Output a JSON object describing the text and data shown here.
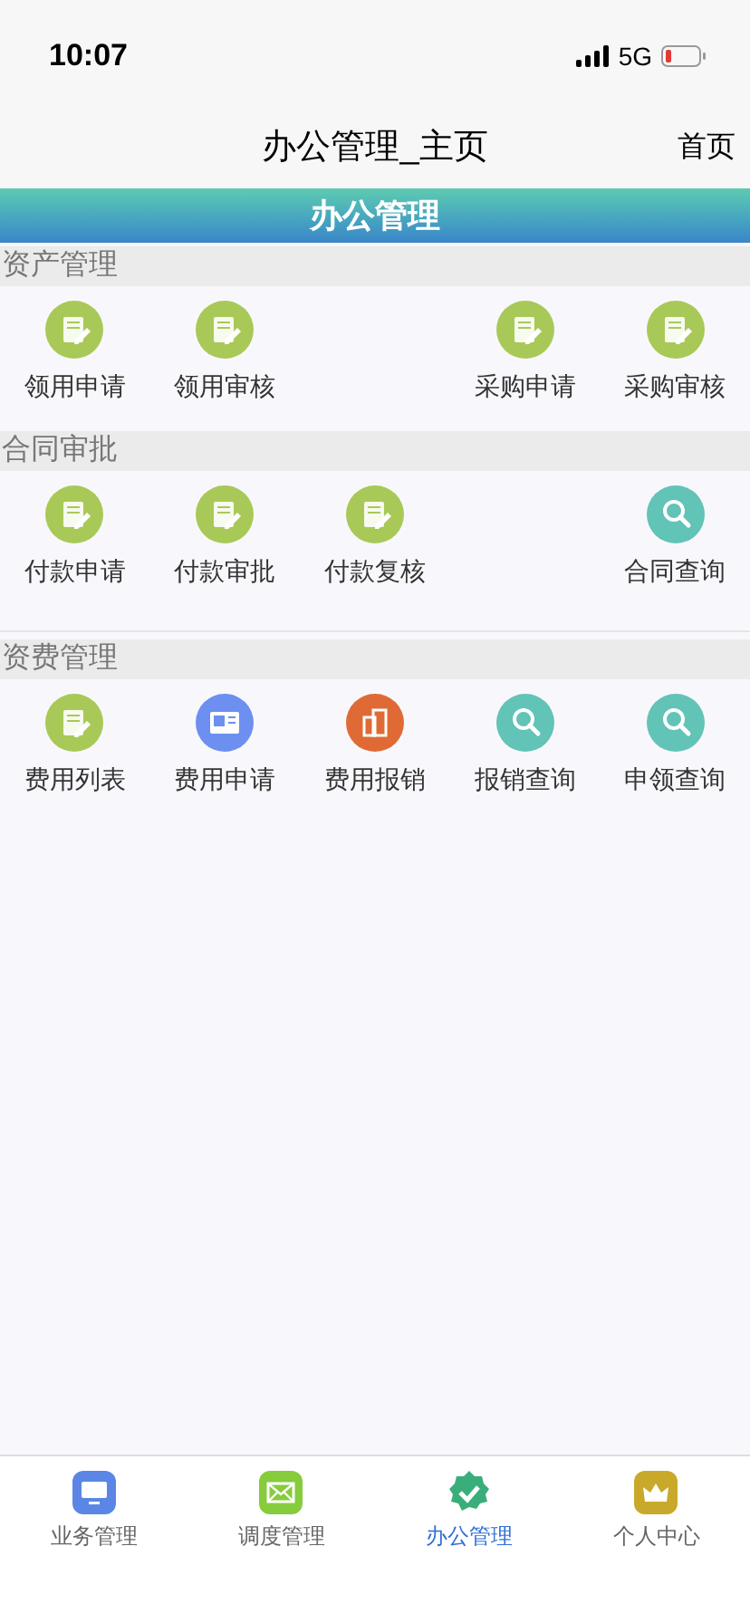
{
  "status_bar": {
    "time": "10:07",
    "network": "5G"
  },
  "nav_bar": {
    "title": "办公管理_主页",
    "action": "首页"
  },
  "banner": {
    "title": "办公管理"
  },
  "sections": [
    {
      "title": "资产管理",
      "items": [
        {
          "kind": "edit",
          "label": "领用申请"
        },
        {
          "kind": "edit",
          "label": "领用审核"
        },
        {
          "kind": "blank"
        },
        {
          "kind": "edit",
          "label": "采购申请"
        },
        {
          "kind": "edit",
          "label": "采购审核"
        }
      ]
    },
    {
      "title": "合同审批",
      "items": [
        {
          "kind": "edit",
          "label": "付款申请"
        },
        {
          "kind": "edit",
          "label": "付款审批"
        },
        {
          "kind": "edit",
          "label": "付款复核"
        },
        {
          "kind": "blank"
        },
        {
          "kind": "search",
          "label": "合同查询"
        }
      ]
    },
    {
      "title": "资费管理",
      "items": [
        {
          "kind": "edit",
          "label": "费用列表"
        },
        {
          "kind": "card",
          "label": "费用申请"
        },
        {
          "kind": "doc",
          "label": "费用报销"
        },
        {
          "kind": "search",
          "label": "报销查询"
        },
        {
          "kind": "search",
          "label": "申领查询"
        }
      ]
    }
  ],
  "tab_bar": [
    {
      "kind": "monitor",
      "label": "业务管理",
      "selected": false
    },
    {
      "kind": "mail",
      "label": "调度管理",
      "selected": false
    },
    {
      "kind": "badge",
      "label": "办公管理",
      "selected": true
    },
    {
      "kind": "crown",
      "label": "个人中心",
      "selected": false
    }
  ]
}
